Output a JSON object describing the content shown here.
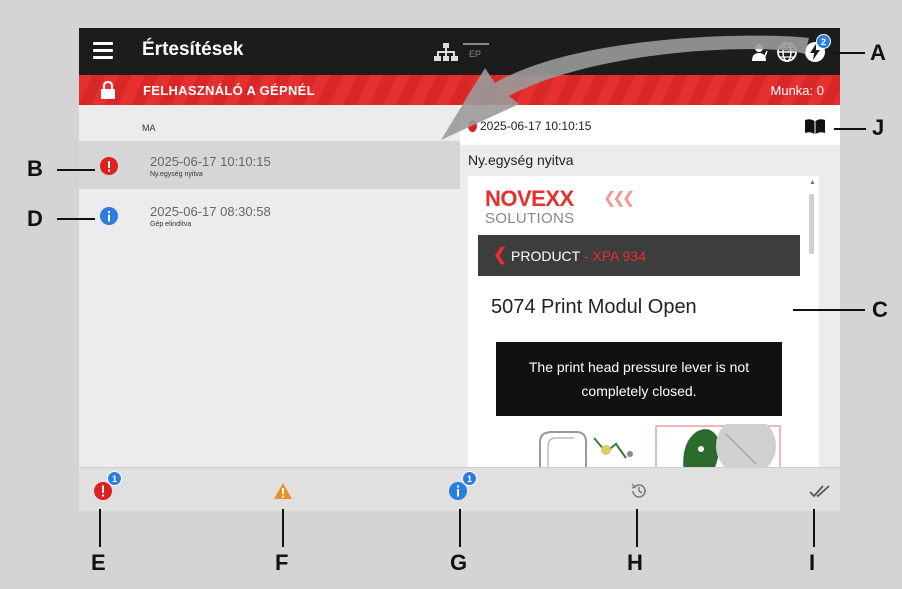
{
  "header": {
    "title": "Értesítések",
    "ep_label": "EP",
    "notification_badge": "2"
  },
  "status": {
    "user_text": "FELHASZNÁLÓ A GÉPNÉL",
    "job_text": "Munka: 0",
    "color": "#e63030"
  },
  "list": {
    "section": "MA",
    "items": [
      {
        "date": "2025-06-17 10:10:15",
        "text": "Ny.egység nyitva",
        "type": "error",
        "selected": true
      },
      {
        "date": "2025-06-17 08:30:58",
        "text": "Gép elindítva",
        "type": "info",
        "selected": false
      }
    ]
  },
  "detail": {
    "date": "2025-06-17 10:10:15",
    "title": "Ny.egység nyitva",
    "doc": {
      "brand": "NOVEXX",
      "brand_sub": "SOLUTIONS",
      "product_label": "PRODUCT",
      "product_model": "- XPA 934",
      "heading": "5074 Print Modul Open",
      "message_line1": "The print head pressure lever is not",
      "message_line2": "completely closed."
    }
  },
  "tabs": {
    "errors_badge": "1",
    "info_badge": "1"
  },
  "callouts": {
    "A": "A",
    "B": "B",
    "C": "C",
    "D": "D",
    "E": "E",
    "F": "F",
    "G": "G",
    "H": "H",
    "I": "I",
    "J": "J"
  },
  "colors": {
    "error": "#e02020",
    "info": "#2a7de1",
    "warning": "#e8902a"
  }
}
